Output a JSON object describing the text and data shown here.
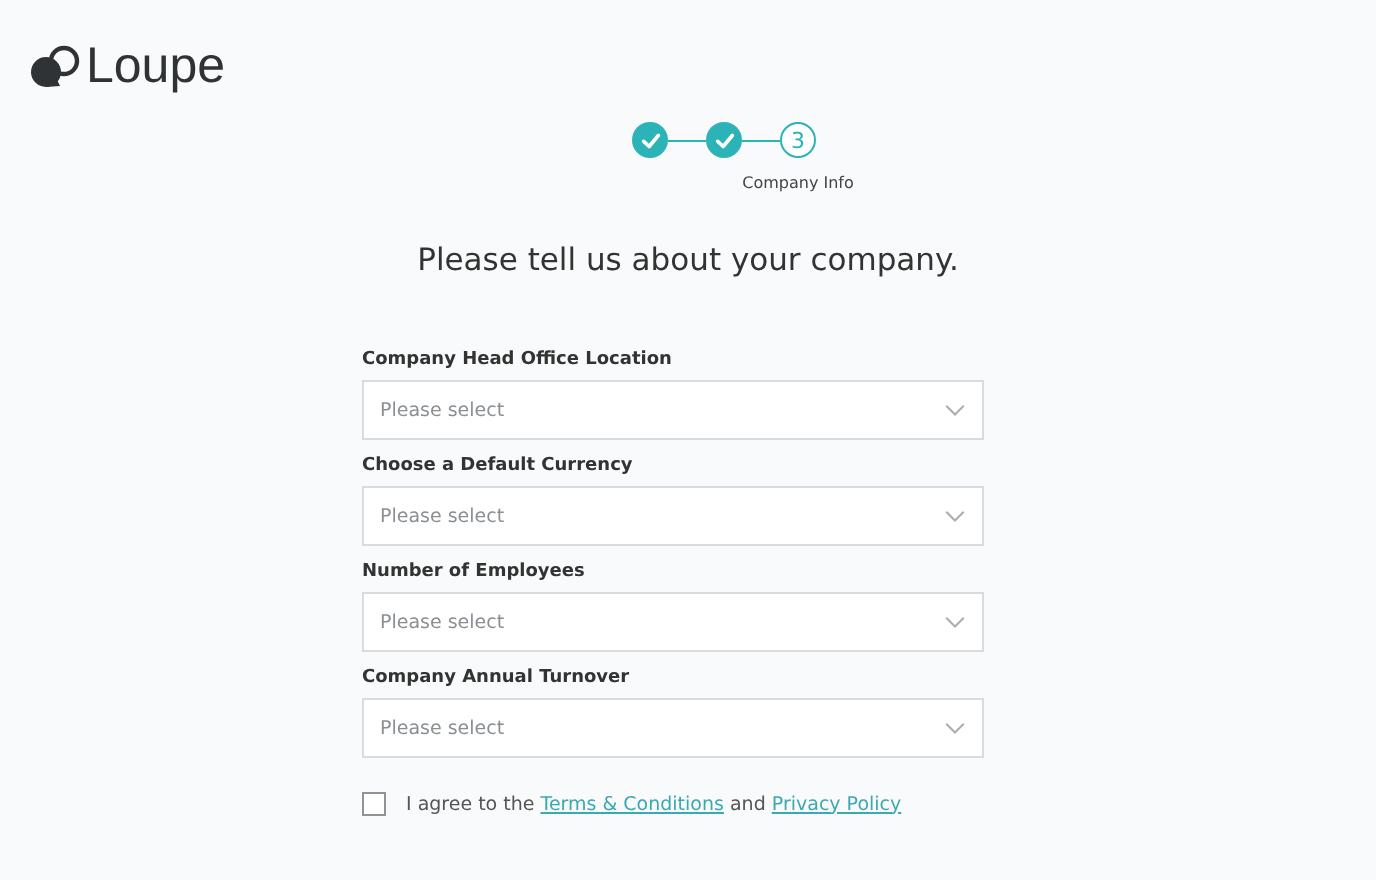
{
  "logo": {
    "text": "Loupe"
  },
  "steps": [
    {
      "kind": "done"
    },
    {
      "kind": "done"
    },
    {
      "kind": "current",
      "number": "3",
      "label": "Company Info"
    }
  ],
  "heading": "Please tell us about your company.",
  "fields": [
    {
      "label": "Company Head Office Location",
      "placeholder": "Please select"
    },
    {
      "label": "Choose a Default Currency",
      "placeholder": "Please select"
    },
    {
      "label": "Number of Employees",
      "placeholder": "Please select"
    },
    {
      "label": "Company Annual Turnover",
      "placeholder": "Please select"
    }
  ],
  "agreement": {
    "checked": false,
    "text_before": "I agree to the",
    "link_terms": "Terms & Conditions",
    "text_middle": "and",
    "link_privacy": "Privacy Policy"
  }
}
